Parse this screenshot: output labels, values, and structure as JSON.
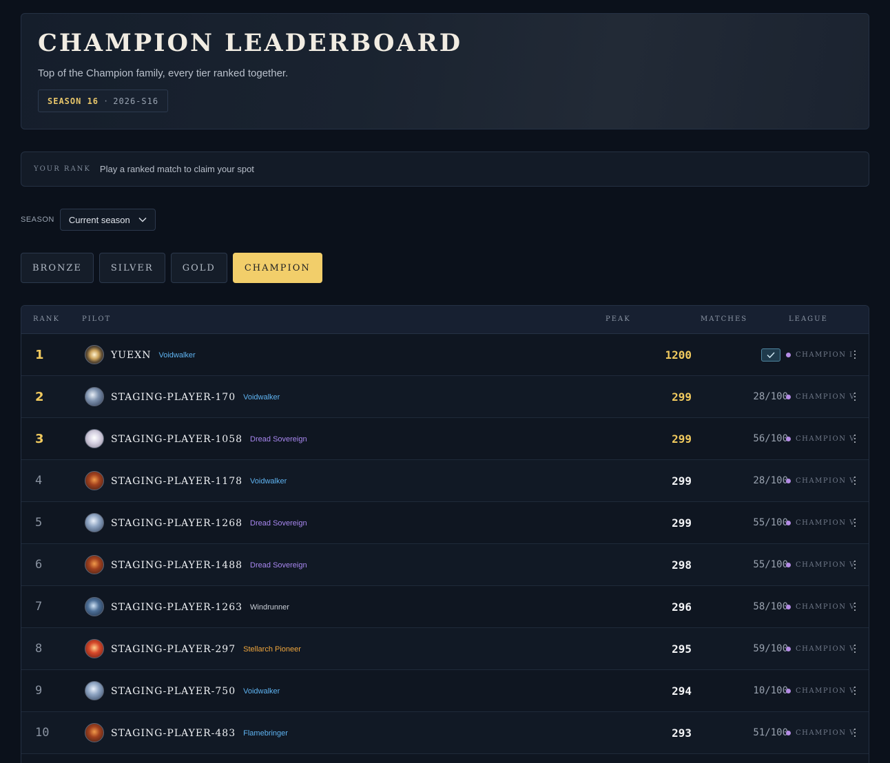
{
  "header": {
    "title": "CHAMPION LEADERBOARD",
    "subtitle": "Top of the Champion family, every tier ranked together.",
    "season_label": "SEASON 16",
    "season_sep": "·",
    "season_code": "2026-S16"
  },
  "your_rank": {
    "label": "YOUR RANK",
    "value": "Play a ranked match to claim your spot"
  },
  "season_filter": {
    "label": "SEASON",
    "selected": "Current season"
  },
  "tiers": [
    {
      "label": "BRONZE",
      "active": false
    },
    {
      "label": "SILVER",
      "active": false
    },
    {
      "label": "GOLD",
      "active": false
    },
    {
      "label": "CHAMPION",
      "active": true
    }
  ],
  "columns": {
    "rank": "RANK",
    "pilot": "PILOT",
    "peak": "PEAK",
    "matches": "MATCHES",
    "league": "LEAGUE"
  },
  "colors": {
    "accent_gold": "#f0c95e",
    "voidwalker": "#5fb4f2",
    "dread_sovereign": "#a887f0",
    "windrunner": "#c9ced6",
    "stellarch_pioneer": "#f0a63c",
    "flamebringer": "#5fb4f2",
    "league_dot": "#b58ce6"
  },
  "rows": [
    {
      "rank": "1",
      "name": "YUEXN",
      "title": "Voidwalker",
      "title_color": "#5fb4f2",
      "peak": "1200",
      "matches": "",
      "verified": true,
      "league": "CHAMPION I",
      "avatar": "sun-emblem"
    },
    {
      "rank": "2",
      "name": "STAGING-PLAYER-170",
      "title": "Voidwalker",
      "title_color": "#5fb4f2",
      "peak": "299",
      "matches": "28/100",
      "verified": false,
      "league": "CHAMPION V",
      "avatar": "silver-emblem"
    },
    {
      "rank": "3",
      "name": "STAGING-PLAYER-1058",
      "title": "Dread Sovereign",
      "title_color": "#a887f0",
      "peak": "299",
      "matches": "56/100",
      "verified": false,
      "league": "CHAMPION V",
      "avatar": "pale-emblem"
    },
    {
      "rank": "4",
      "name": "STAGING-PLAYER-1178",
      "title": "Voidwalker",
      "title_color": "#5fb4f2",
      "peak": "299",
      "matches": "28/100",
      "verified": false,
      "league": "CHAMPION V",
      "avatar": "ember-emblem"
    },
    {
      "rank": "5",
      "name": "STAGING-PLAYER-1268",
      "title": "Dread Sovereign",
      "title_color": "#a887f0",
      "peak": "299",
      "matches": "55/100",
      "verified": false,
      "league": "CHAMPION V",
      "avatar": "frost-emblem"
    },
    {
      "rank": "6",
      "name": "STAGING-PLAYER-1488",
      "title": "Dread Sovereign",
      "title_color": "#a887f0",
      "peak": "298",
      "matches": "55/100",
      "verified": false,
      "league": "CHAMPION V",
      "avatar": "ember-emblem"
    },
    {
      "rank": "7",
      "name": "STAGING-PLAYER-1263",
      "title": "Windrunner",
      "title_color": "#c9ced6",
      "peak": "296",
      "matches": "58/100",
      "verified": false,
      "league": "CHAMPION V",
      "avatar": "storm-emblem"
    },
    {
      "rank": "8",
      "name": "STAGING-PLAYER-297",
      "title": "Stellarch Pioneer",
      "title_color": "#f0a63c",
      "peak": "295",
      "matches": "59/100",
      "verified": false,
      "league": "CHAMPION V",
      "avatar": "flame-emblem"
    },
    {
      "rank": "9",
      "name": "STAGING-PLAYER-750",
      "title": "Voidwalker",
      "title_color": "#5fb4f2",
      "peak": "294",
      "matches": "10/100",
      "verified": false,
      "league": "CHAMPION V",
      "avatar": "frost-emblem"
    },
    {
      "rank": "10",
      "name": "STAGING-PLAYER-483",
      "title": "Flamebringer",
      "title_color": "#5fb4f2",
      "peak": "293",
      "matches": "51/100",
      "verified": false,
      "league": "CHAMPION V",
      "avatar": "ember-emblem"
    }
  ]
}
